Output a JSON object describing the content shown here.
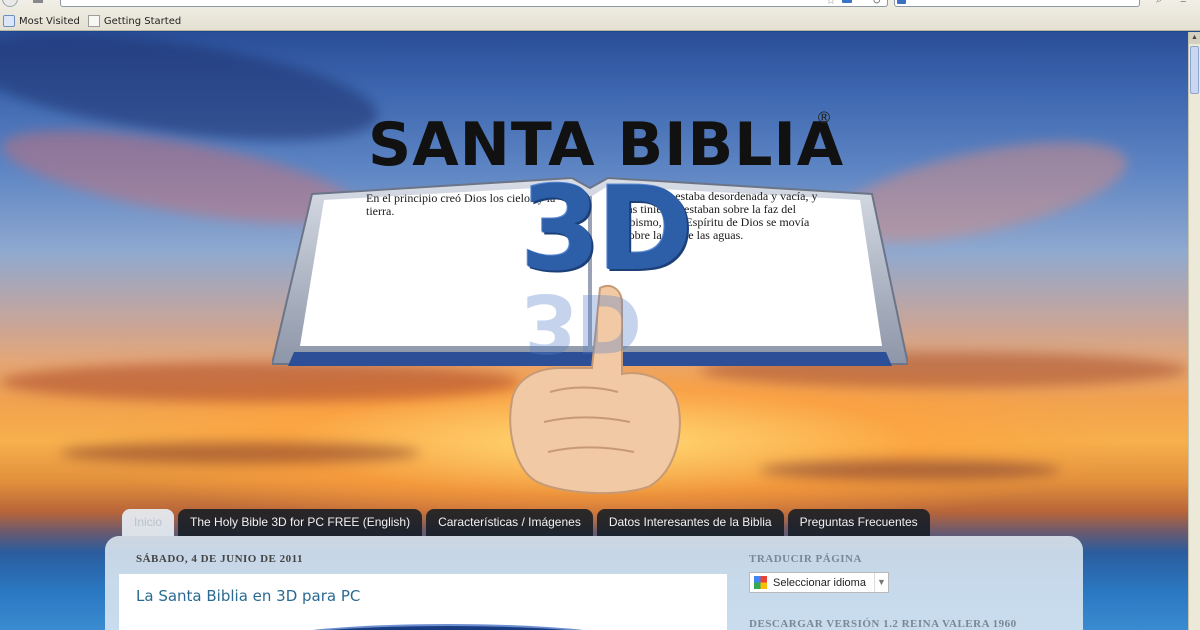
{
  "browser": {
    "bookmarks": [
      {
        "label": "Most Visited"
      },
      {
        "label": "Getting Started"
      }
    ]
  },
  "header": {
    "site_title": "SANTA BIBLIA",
    "registered_mark": "®",
    "logo_3d": "3D",
    "book_text_left": "En el principio creó Dios los cielos y la tierra.",
    "book_text_right": "Y la tierra estaba desordenada y vacía, y las tinieblas estaban sobre la faz del abismo, y el Espíritu de Dios se movía sobre la faz de las aguas."
  },
  "nav": {
    "tabs": [
      {
        "label": "Inicio",
        "active": true
      },
      {
        "label": "The Holy Bible 3D for PC FREE (English)",
        "active": false
      },
      {
        "label": "Características / Imágenes",
        "active": false
      },
      {
        "label": "Datos Interesantes de la Biblia",
        "active": false
      },
      {
        "label": "Preguntas Frecuentes",
        "active": false
      }
    ]
  },
  "main": {
    "post_date": "SÁBADO, 4 DE JUNIO DE 2011",
    "post_title": "La Santa Biblia en 3D para PC"
  },
  "sidebar": {
    "translate_title": "TRADUCIR PÁGINA",
    "translate_select": "Seleccionar idioma",
    "download_title": "DESCARGAR VERSIÓN 1.2 REINA VALERA 1960"
  },
  "colors": {
    "tab_bg": "#141c24",
    "tab_active_bg": "#e6eef4",
    "post_title": "#2a6a92",
    "logo_blue": "#2d5ea8"
  }
}
